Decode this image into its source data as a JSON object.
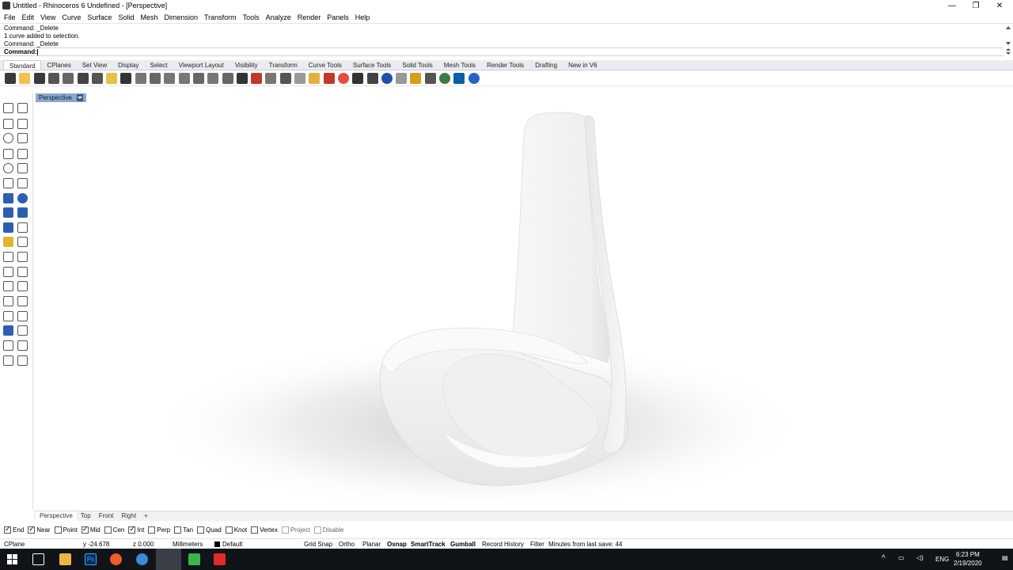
{
  "window": {
    "title": "Untitled - Rhinoceros 6 Undefined - [Perspective]",
    "minimize": "—",
    "restore": "❐",
    "close": "✕"
  },
  "menu": [
    "File",
    "Edit",
    "View",
    "Curve",
    "Surface",
    "Solid",
    "Mesh",
    "Dimension",
    "Transform",
    "Tools",
    "Analyze",
    "Render",
    "Panels",
    "Help"
  ],
  "command": {
    "history": [
      "Command: _Delete",
      "1 curve added to selection.",
      "Command: _Delete"
    ],
    "prompt": "Command:"
  },
  "toolbar_tabs": [
    "Standard",
    "CPlanes",
    "Set View",
    "Display",
    "Select",
    "Viewport Layout",
    "Visibility",
    "Transform",
    "Curve Tools",
    "Surface Tools",
    "Solid Tools",
    "Mesh Tools",
    "Render Tools",
    "Drafting",
    "New in V6"
  ],
  "toolbar_icons": [
    "new-file",
    "open-file",
    "save",
    "print",
    "import",
    "cut",
    "copy",
    "paste",
    "undo",
    "pan",
    "rotate-view",
    "zoom",
    "zoom-window",
    "zoom-extents",
    "zoom-selected",
    "undo-view",
    "four-viewports",
    "show-objects",
    "hide-objects",
    "lock",
    "light",
    "bulb",
    "material",
    "color-wheel",
    "shaded",
    "rendered",
    "sphere",
    "ghosted",
    "wand",
    "options",
    "grid",
    "render",
    "help"
  ],
  "viewport": {
    "label": "Perspective",
    "tabs": [
      "Perspective",
      "Top",
      "Front",
      "Right"
    ],
    "add_tab": "+"
  },
  "osnaps": [
    {
      "label": "End",
      "on": true
    },
    {
      "label": "Near",
      "on": true
    },
    {
      "label": "Point",
      "on": false
    },
    {
      "label": "Mid",
      "on": true
    },
    {
      "label": "Cen",
      "on": false
    },
    {
      "label": "Int",
      "on": true
    },
    {
      "label": "Perp",
      "on": false
    },
    {
      "label": "Tan",
      "on": false
    },
    {
      "label": "Quad",
      "on": false
    },
    {
      "label": "Knot",
      "on": false
    },
    {
      "label": "Vertex",
      "on": false
    },
    {
      "label": "Project",
      "on": false,
      "dim": true
    },
    {
      "label": "Disable",
      "on": false,
      "dim": true
    }
  ],
  "status": {
    "cplane": "CPlane",
    "y": "y -24.678",
    "z": "z 0.000",
    "units": "Millimeters",
    "layer": "Default",
    "grid_snap": "Grid Snap",
    "ortho": "Ortho",
    "planar": "Planar",
    "osnap": "Osnap",
    "smarttrack": "SmartTrack",
    "gumball": "Gumball",
    "record_history": "Record History",
    "filter": "Filter",
    "last_save": "Minutes from last save: 44"
  },
  "taskbar": {
    "lang": "ENG",
    "time": "6:23 PM",
    "date": "2/19/2020",
    "ps_label": "Ps"
  },
  "colors": {
    "viewport_label_bg": "#8ea7cb",
    "taskbar_bg": "#101418",
    "chair": "#f4f4f4"
  }
}
